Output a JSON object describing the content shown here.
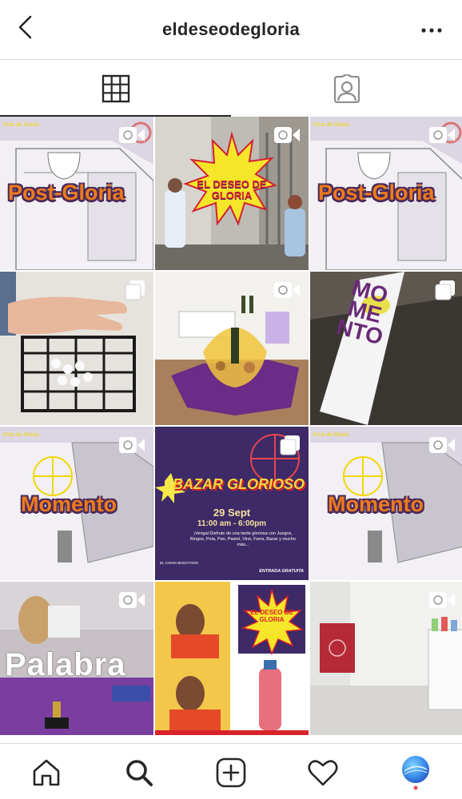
{
  "header": {
    "username": "eldeseodegloria"
  },
  "tabs": [
    {
      "name": "grid",
      "active": true
    },
    {
      "name": "tagged",
      "active": false
    }
  ],
  "posts": [
    {
      "kind": "video",
      "text": "Post-Gloria"
    },
    {
      "kind": "video",
      "text": "EL DESEO DE GLORIA"
    },
    {
      "kind": "video",
      "text": "Post-Gloria"
    },
    {
      "kind": "carousel",
      "text": ""
    },
    {
      "kind": "video",
      "text": ""
    },
    {
      "kind": "carousel",
      "text": "MOMENTO"
    },
    {
      "kind": "video",
      "text": "Momento"
    },
    {
      "kind": "carousel",
      "text": "BAZAR GLORIOSO",
      "date": "29 Sept",
      "time": "11:00 am - 6:00pm",
      "desc": "¡Vengal Disfrute de una tarde gloriosa con Juegos, Bingos, Pola, Pan, Pastel, Vino, Farra, Bazar y mucho más...",
      "venue": "EL CHINO BOGOTANO",
      "entry": "ENTRADA GRATUITA"
    },
    {
      "kind": "video",
      "text": "Momento"
    },
    {
      "kind": "video",
      "text": "Palabra"
    },
    {
      "kind": "image",
      "text": "EL DESEO DE GLORIA"
    },
    {
      "kind": "video",
      "text": ""
    }
  ],
  "colors": {
    "accent": "#ed7b1b",
    "outline": "#4a2a5a",
    "notification": "#ed4956"
  },
  "bottom_nav": [
    "home-icon",
    "search-icon",
    "new-post-icon",
    "activity-heart-icon",
    "profile-avatar"
  ]
}
